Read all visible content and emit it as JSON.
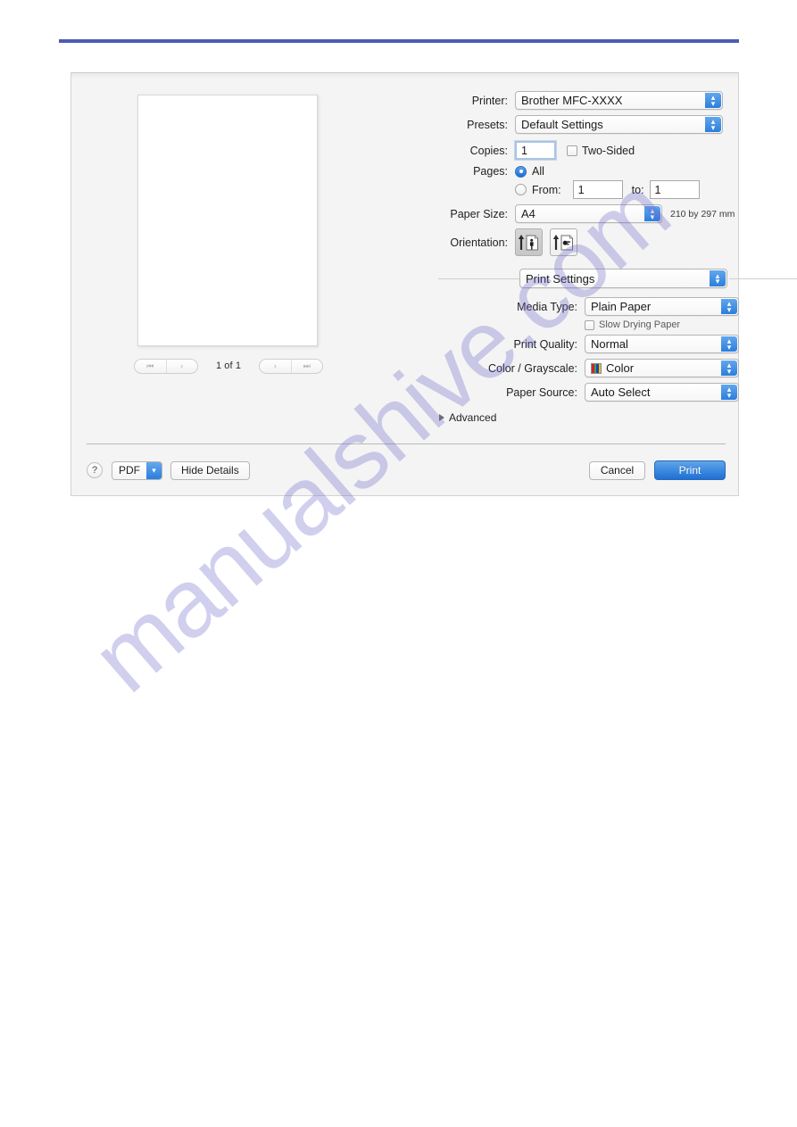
{
  "page": {
    "watermark_text": "manualshive.com",
    "rule_color": "#4a5db5"
  },
  "dialog": {
    "preview": {
      "first_page_icon": "skip-to-first-icon",
      "prev_page_icon": "previous-page-icon",
      "next_page_icon": "next-page-icon",
      "last_page_icon": "skip-to-last-icon",
      "page_counter": "1 of 1"
    },
    "printer": {
      "label": "Printer:",
      "value": "Brother MFC-XXXX"
    },
    "presets": {
      "label": "Presets:",
      "value": "Default Settings"
    },
    "copies": {
      "label": "Copies:",
      "value": "1",
      "two_sided_label": "Two-Sided"
    },
    "pages": {
      "label": "Pages:",
      "all_label": "All",
      "from_label": "From:",
      "from_value": "1",
      "to_label": "to:",
      "to_value": "1"
    },
    "paper_size": {
      "label": "Paper Size:",
      "value": "A4",
      "dimensions": "210 by 297 mm"
    },
    "orientation": {
      "label": "Orientation:",
      "portrait_icon": "portrait-orientation-icon",
      "landscape_icon": "landscape-orientation-icon"
    },
    "pane_popup": {
      "value": "Print Settings"
    },
    "media_type": {
      "label": "Media Type:",
      "value": "Plain Paper"
    },
    "slow_drying": {
      "label": "Slow Drying Paper"
    },
    "print_quality": {
      "label": "Print Quality:",
      "value": "Normal"
    },
    "color_grayscale": {
      "label": "Color / Grayscale:",
      "value": "Color",
      "swatch_colors": [
        "#d8202a",
        "#2fa84f",
        "#1f45b0",
        "#e8c21e"
      ]
    },
    "paper_source": {
      "label": "Paper Source:",
      "value": "Auto Select"
    },
    "advanced": {
      "label": "Advanced"
    },
    "footer": {
      "help_label": "?",
      "pdf_label": "PDF",
      "hide_details_label": "Hide Details",
      "cancel_label": "Cancel",
      "print_label": "Print"
    }
  }
}
